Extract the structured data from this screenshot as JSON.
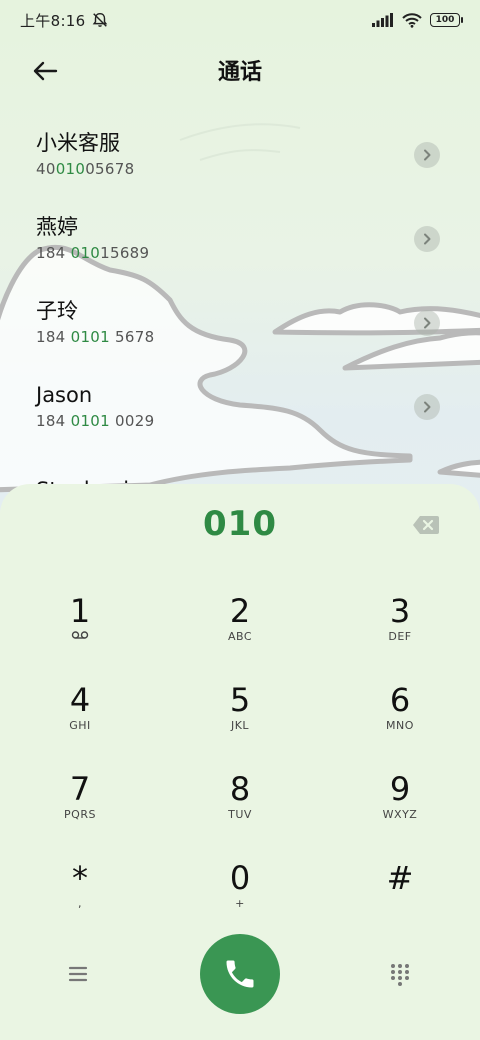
{
  "status_bar": {
    "time": "上午8:16",
    "battery": "100"
  },
  "header": {
    "title": "通话"
  },
  "contacts": [
    {
      "name": "小米客服",
      "number_pre": "400",
      "number_match": "1005678",
      "number_post": "",
      "number_match_part": "010",
      "display": [
        "40",
        "010",
        "05678"
      ]
    },
    {
      "name": "燕婷",
      "display": [
        "184 ",
        "010",
        "15689"
      ]
    },
    {
      "name": "子玲",
      "display": [
        "184 ",
        "0101",
        " 5678"
      ]
    },
    {
      "name": "Jason",
      "display": [
        "184 ",
        "0101",
        " 0029"
      ]
    },
    {
      "name": "Stephanie",
      "display": [
        "",
        "",
        ""
      ]
    }
  ],
  "dialer": {
    "input": "010",
    "keys": [
      {
        "digit": "1",
        "letters": ""
      },
      {
        "digit": "2",
        "letters": "ABC"
      },
      {
        "digit": "3",
        "letters": "DEF"
      },
      {
        "digit": "4",
        "letters": "GHI"
      },
      {
        "digit": "5",
        "letters": "JKL"
      },
      {
        "digit": "6",
        "letters": "MNO"
      },
      {
        "digit": "7",
        "letters": "PQRS"
      },
      {
        "digit": "8",
        "letters": "TUV"
      },
      {
        "digit": "9",
        "letters": "WXYZ"
      },
      {
        "digit": "*",
        "letters": ","
      },
      {
        "digit": "0",
        "letters": "+"
      },
      {
        "digit": "#",
        "letters": ""
      }
    ]
  },
  "colors": {
    "accent": "#2f8a44",
    "call_button": "#3a9653",
    "panel_bg": "#eaf5e3"
  }
}
